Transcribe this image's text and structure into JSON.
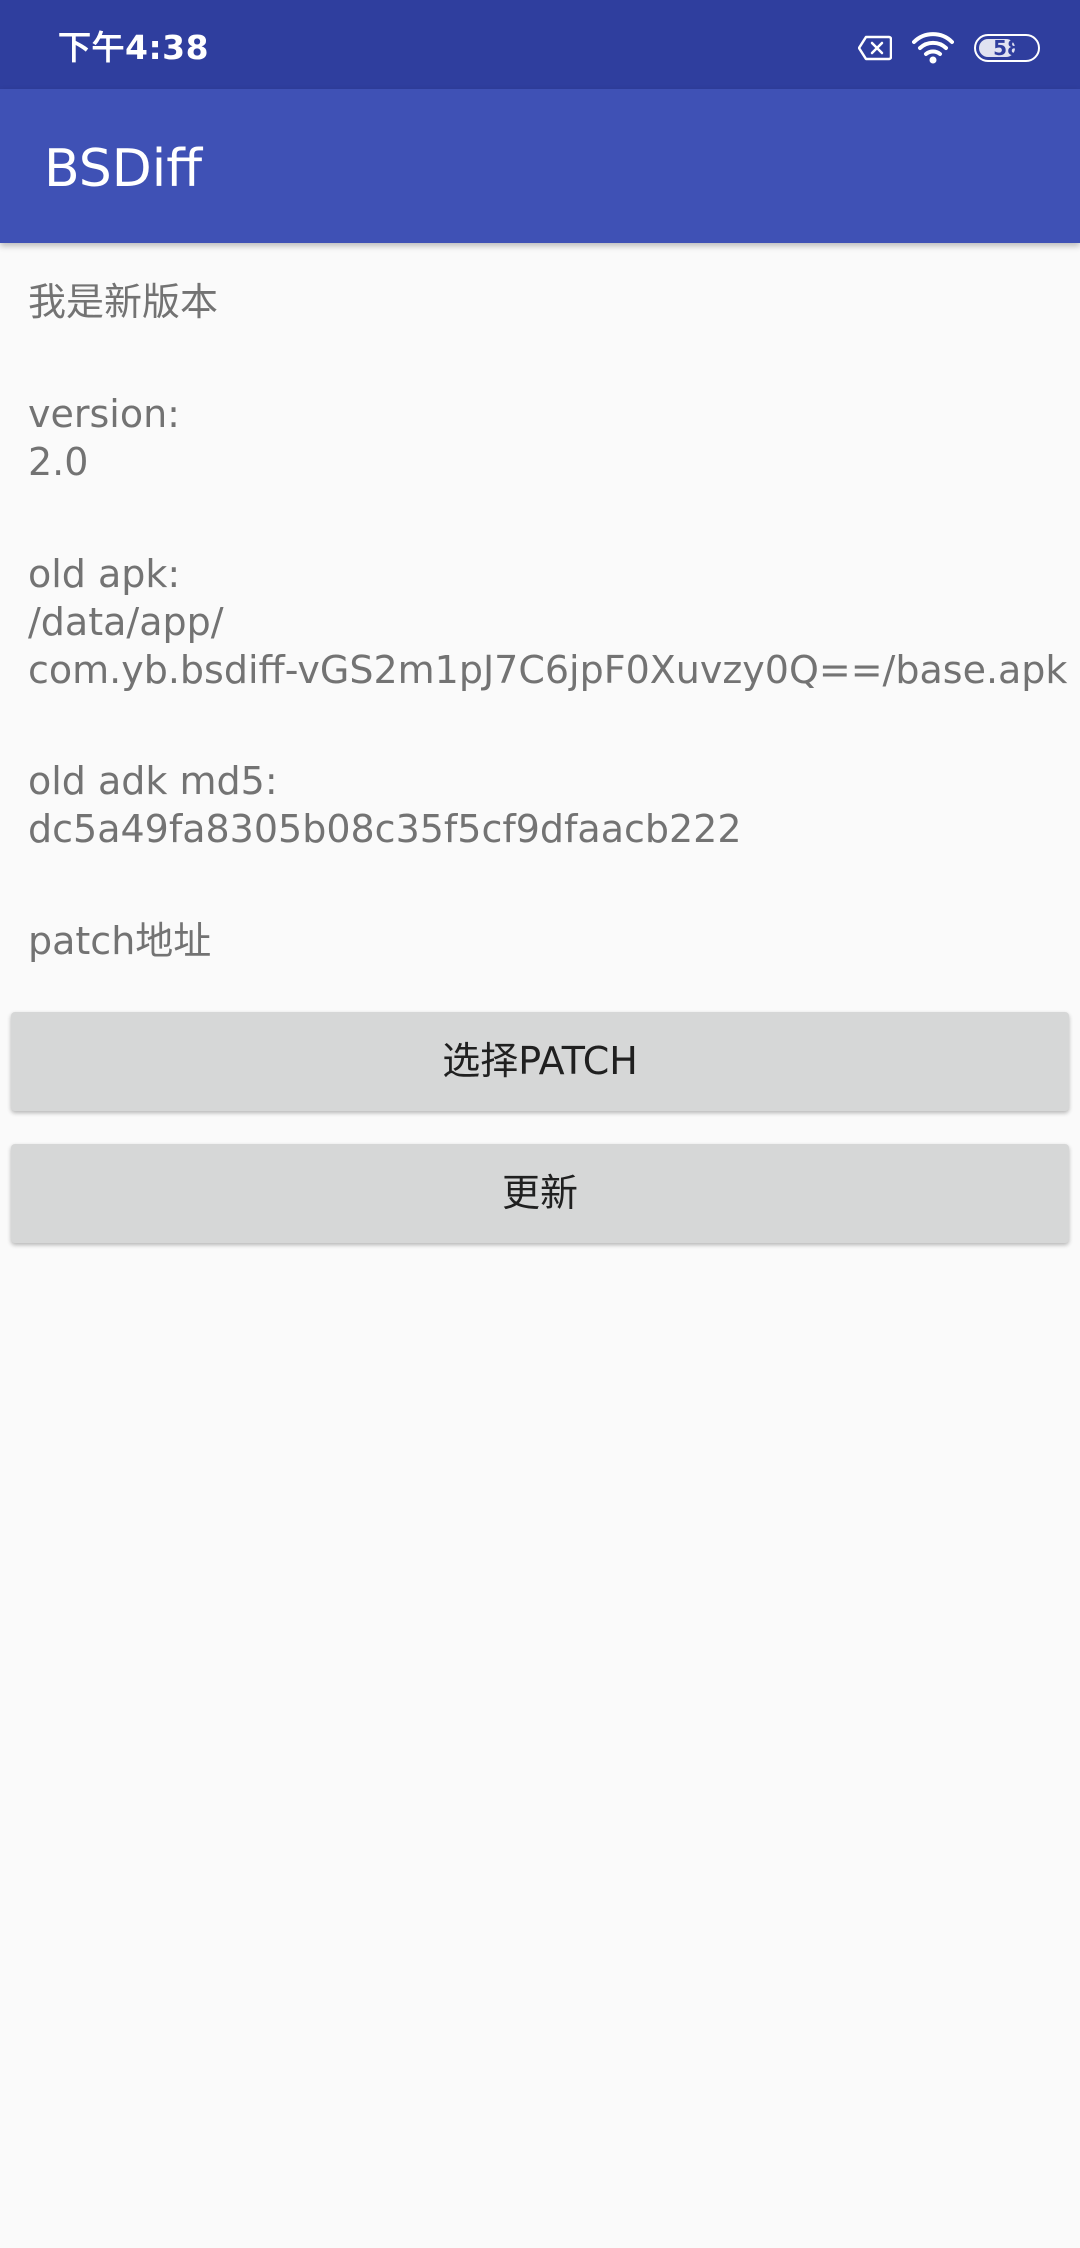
{
  "status_bar": {
    "time": "下午4:38",
    "battery_level": "58",
    "icons": [
      "sim-card-off-icon",
      "wifi-icon",
      "battery-icon"
    ]
  },
  "app_bar": {
    "title": "BSDiff"
  },
  "content": {
    "new_version_text": "我是新版本",
    "version_text": "version:\n2.0",
    "old_apk_text": "old apk:\n/data/app/\ncom.yb.bsdiff-vGS2m1pJ7C6jpF0Xuvzy0Q==/base.apk",
    "old_md5_text": "old adk md5:\ndc5a49fa8305b08c35f5cf9dfaacb222",
    "patch_address_text": "patch地址"
  },
  "buttons": {
    "select_patch": "选择PATCH",
    "update": "更新"
  },
  "colors": {
    "status_bar": "#2f3e9e",
    "app_bar": "#3f51b5",
    "button_bg": "#d6d7d7",
    "text_gray": "#737373"
  }
}
